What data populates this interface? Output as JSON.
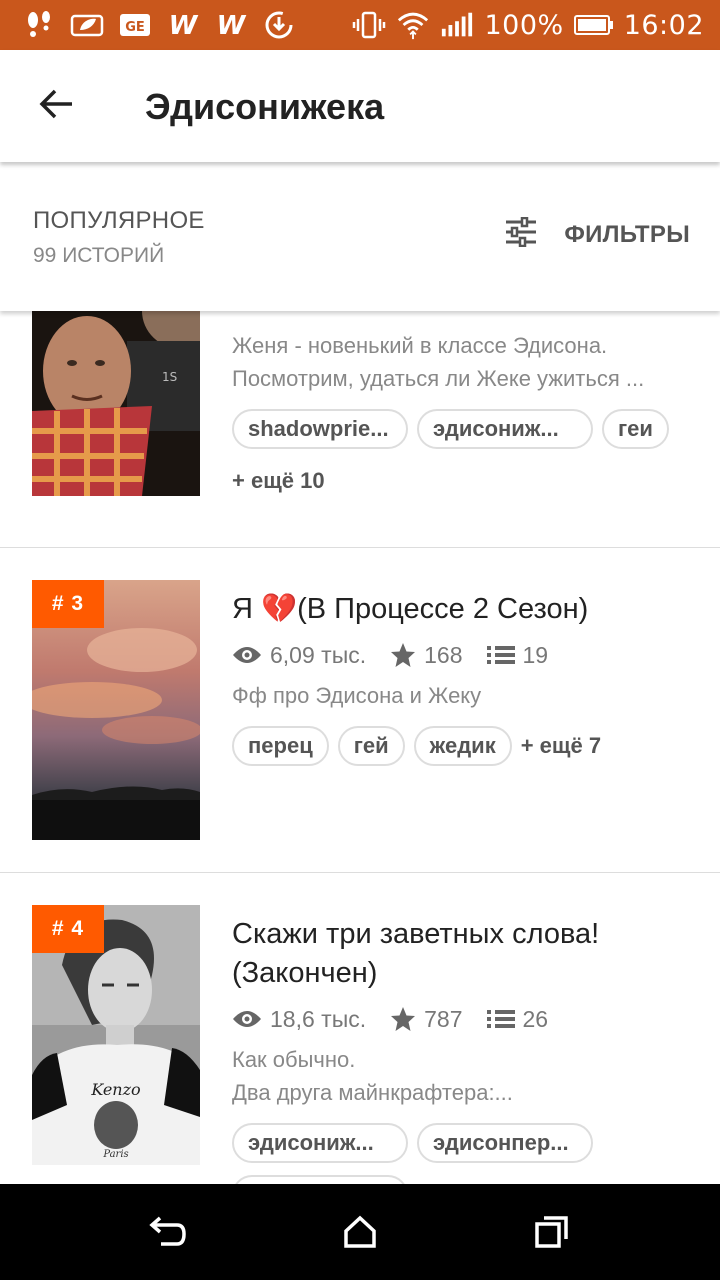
{
  "status_bar": {
    "battery": "100%",
    "time": "16:02",
    "accent": "#c9571c"
  },
  "toolbar": {
    "title": "Эдисонижека"
  },
  "sort_bar": {
    "title": "ПОПУЛЯРНОЕ",
    "count": "99 ИСТОРИЙ",
    "filter_label": "ФИЛЬТРЫ"
  },
  "stories": [
    {
      "description": "Женя - новенький в классе Эдисона. Посмотрим, удаться ли Жеке ужиться ...",
      "tags": [
        "shadowprie...",
        "эдисониж...",
        "геи"
      ],
      "more_tags": "+ ещё 10"
    },
    {
      "rank": "# 3",
      "title": "Я 💔(В Процессе 2 Сезон)",
      "views": "6,09 тыс.",
      "votes": "168",
      "parts": "19",
      "description": "Фф про Эдисона и Жеку",
      "tags": [
        "перец",
        "гей",
        "жедик"
      ],
      "more_tags": "+ ещё 7"
    },
    {
      "rank": "# 4",
      "title": "Скажи три заветных слова! (Закончен)",
      "views": "18,6 тыс.",
      "votes": "787",
      "parts": "26",
      "description_line1": "Как обычно.",
      "description_line2": "Два друга майнкрафтера:...",
      "tags": [
        "эдисониж...",
        "эдисонпер..."
      ]
    }
  ],
  "colors": {
    "rank_badge": "#ff5a00",
    "nav_bar": "#000000"
  }
}
